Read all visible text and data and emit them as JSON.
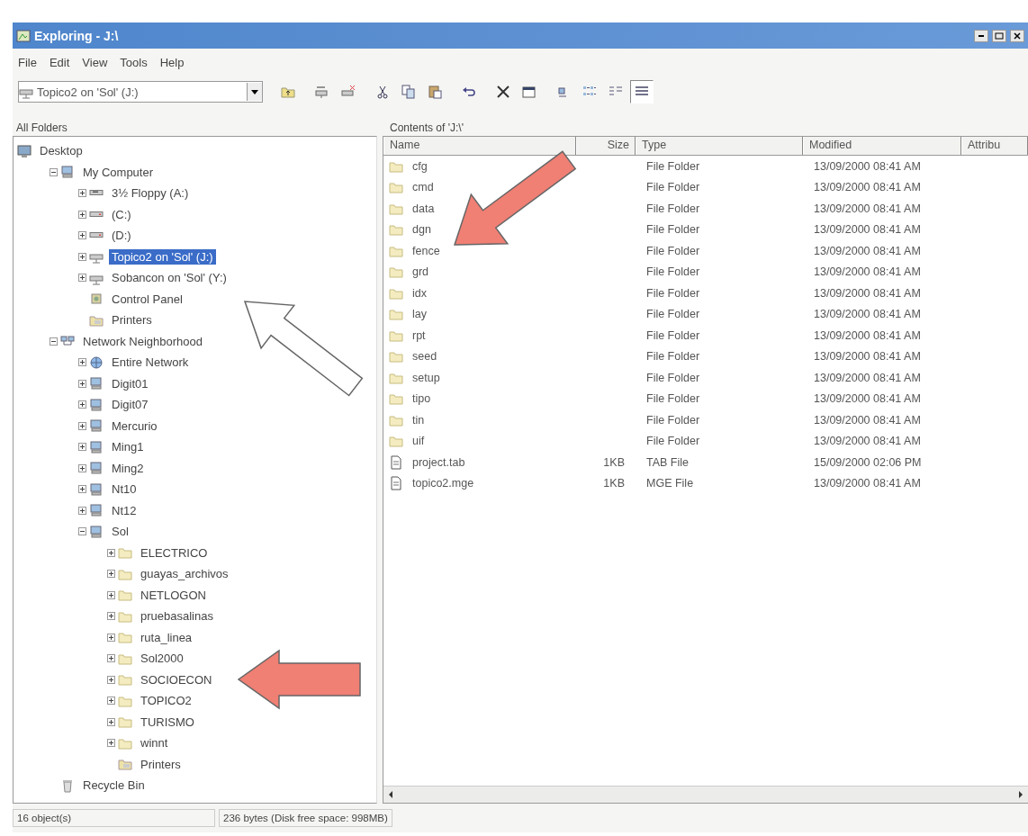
{
  "window": {
    "title": "Exploring - J:\\"
  },
  "menu": [
    "File",
    "Edit",
    "View",
    "Tools",
    "Help"
  ],
  "address": {
    "value": "Topico2 on 'Sol' (J:)"
  },
  "toolbar": [
    {
      "kind": "up",
      "pressed": false
    },
    {
      "kind": "map-drive",
      "pressed": false
    },
    {
      "kind": "disconnect",
      "pressed": false
    },
    {
      "kind": "cut",
      "pressed": false
    },
    {
      "kind": "copy",
      "pressed": false
    },
    {
      "kind": "paste",
      "pressed": false
    },
    {
      "kind": "undo",
      "pressed": false
    },
    {
      "kind": "delete",
      "pressed": false
    },
    {
      "kind": "properties",
      "pressed": false
    },
    {
      "kind": "large-icons",
      "pressed": false
    },
    {
      "kind": "small-icons",
      "pressed": false
    },
    {
      "kind": "list",
      "pressed": false
    },
    {
      "kind": "details",
      "pressed": true
    }
  ],
  "tree_label": "All Folders",
  "contents_label": "Contents of 'J:\\'",
  "tree": [
    {
      "label": "Desktop",
      "kind": "desktop",
      "selected": false,
      "children": [
        {
          "label": "My Computer",
          "kind": "computer",
          "expanded": true,
          "selected": false,
          "children": [
            {
              "label": "3½ Floppy (A:)",
              "kind": "floppy",
              "expanded": false,
              "selected": false
            },
            {
              "label": "(C:)",
              "kind": "drive",
              "expanded": false,
              "selected": false
            },
            {
              "label": "(D:)",
              "kind": "drive",
              "expanded": false,
              "selected": false
            },
            {
              "label": "Topico2 on 'Sol' (J:)",
              "kind": "netdrive",
              "expanded": false,
              "selected": true
            },
            {
              "label": "Sobancon on 'Sol' (Y:)",
              "kind": "netdrive",
              "expanded": false,
              "selected": false
            },
            {
              "label": "Control Panel",
              "kind": "control-panel",
              "selected": false
            },
            {
              "label": "Printers",
              "kind": "printers",
              "selected": false
            }
          ]
        },
        {
          "label": "Network Neighborhood",
          "kind": "network",
          "expanded": true,
          "selected": false,
          "children": [
            {
              "label": "Entire Network",
              "kind": "globe",
              "expanded": false,
              "selected": false
            },
            {
              "label": "Digit01",
              "kind": "computer",
              "expanded": false,
              "selected": false
            },
            {
              "label": "Digit07",
              "kind": "computer",
              "expanded": false,
              "selected": false
            },
            {
              "label": "Mercurio",
              "kind": "computer",
              "expanded": false,
              "selected": false
            },
            {
              "label": "Ming1",
              "kind": "computer",
              "expanded": false,
              "selected": false
            },
            {
              "label": "Ming2",
              "kind": "computer",
              "expanded": false,
              "selected": false
            },
            {
              "label": "Nt10",
              "kind": "computer",
              "expanded": false,
              "selected": false
            },
            {
              "label": "Nt12",
              "kind": "computer",
              "expanded": false,
              "selected": false
            },
            {
              "label": "Sol",
              "kind": "computer",
              "expanded": true,
              "selected": false,
              "children": [
                {
                  "label": "ELECTRICO",
                  "kind": "share",
                  "expanded": false,
                  "selected": false
                },
                {
                  "label": "guayas_archivos",
                  "kind": "share",
                  "expanded": false,
                  "selected": false
                },
                {
                  "label": "NETLOGON",
                  "kind": "share",
                  "expanded": false,
                  "selected": false
                },
                {
                  "label": "pruebasalinas",
                  "kind": "share",
                  "expanded": false,
                  "selected": false
                },
                {
                  "label": "ruta_linea",
                  "kind": "share",
                  "expanded": false,
                  "selected": false
                },
                {
                  "label": "Sol2000",
                  "kind": "share",
                  "expanded": false,
                  "selected": false
                },
                {
                  "label": "SOCIOECON",
                  "kind": "share",
                  "expanded": false,
                  "selected": false
                },
                {
                  "label": "TOPICO2",
                  "kind": "share",
                  "expanded": false,
                  "selected": false
                },
                {
                  "label": "TURISMO",
                  "kind": "share",
                  "expanded": false,
                  "selected": false
                },
                {
                  "label": "winnt",
                  "kind": "share",
                  "expanded": false,
                  "selected": false
                },
                {
                  "label": "Printers",
                  "kind": "printers",
                  "selected": false
                }
              ]
            }
          ]
        },
        {
          "label": "Recycle Bin",
          "kind": "recycle",
          "selected": false
        }
      ]
    }
  ],
  "table": {
    "columns": [
      "Name",
      "Size",
      "Type",
      "Modified",
      "Attribu"
    ],
    "rows": [
      {
        "kind": "folder",
        "name": "cfg",
        "type": "File Folder",
        "modified": "13/09/2000 08:41 AM"
      },
      {
        "kind": "folder",
        "name": "cmd",
        "type": "File Folder",
        "modified": "13/09/2000 08:41 AM"
      },
      {
        "kind": "folder",
        "name": "data",
        "type": "File Folder",
        "modified": "13/09/2000 08:41 AM"
      },
      {
        "kind": "folder",
        "name": "dgn",
        "type": "File Folder",
        "modified": "13/09/2000 08:41 AM"
      },
      {
        "kind": "folder",
        "name": "fence",
        "type": "File Folder",
        "modified": "13/09/2000 08:41 AM"
      },
      {
        "kind": "folder",
        "name": "grd",
        "type": "File Folder",
        "modified": "13/09/2000 08:41 AM"
      },
      {
        "kind": "folder",
        "name": "idx",
        "type": "File Folder",
        "modified": "13/09/2000 08:41 AM"
      },
      {
        "kind": "folder",
        "name": "lay",
        "type": "File Folder",
        "modified": "13/09/2000 08:41 AM"
      },
      {
        "kind": "folder",
        "name": "rpt",
        "type": "File Folder",
        "modified": "13/09/2000 08:41 AM"
      },
      {
        "kind": "folder",
        "name": "seed",
        "type": "File Folder",
        "modified": "13/09/2000 08:41 AM"
      },
      {
        "kind": "folder",
        "name": "setup",
        "type": "File Folder",
        "modified": "13/09/2000 08:41 AM"
      },
      {
        "kind": "folder",
        "name": "tipo",
        "type": "File Folder",
        "modified": "13/09/2000 08:41 AM"
      },
      {
        "kind": "folder",
        "name": "tin",
        "type": "File Folder",
        "modified": "13/09/2000 08:41 AM"
      },
      {
        "kind": "folder",
        "name": "uif",
        "type": "File Folder",
        "modified": "13/09/2000 08:41 AM"
      },
      {
        "kind": "file",
        "name": "project.tab",
        "size": "1KB",
        "type": "TAB File",
        "modified": "15/09/2000 02:06 PM"
      },
      {
        "kind": "file",
        "name": "topico2.mge",
        "size": "1KB",
        "type": "MGE File",
        "modified": "13/09/2000 08:41 AM"
      }
    ]
  },
  "status_bar": [
    "16 object(s)",
    "236 bytes (Disk free space: 998MB)"
  ],
  "callout_arrows": [
    {
      "color": "#f07f74"
    },
    {
      "color": "#ffffff"
    },
    {
      "color": "#f07f74"
    }
  ]
}
